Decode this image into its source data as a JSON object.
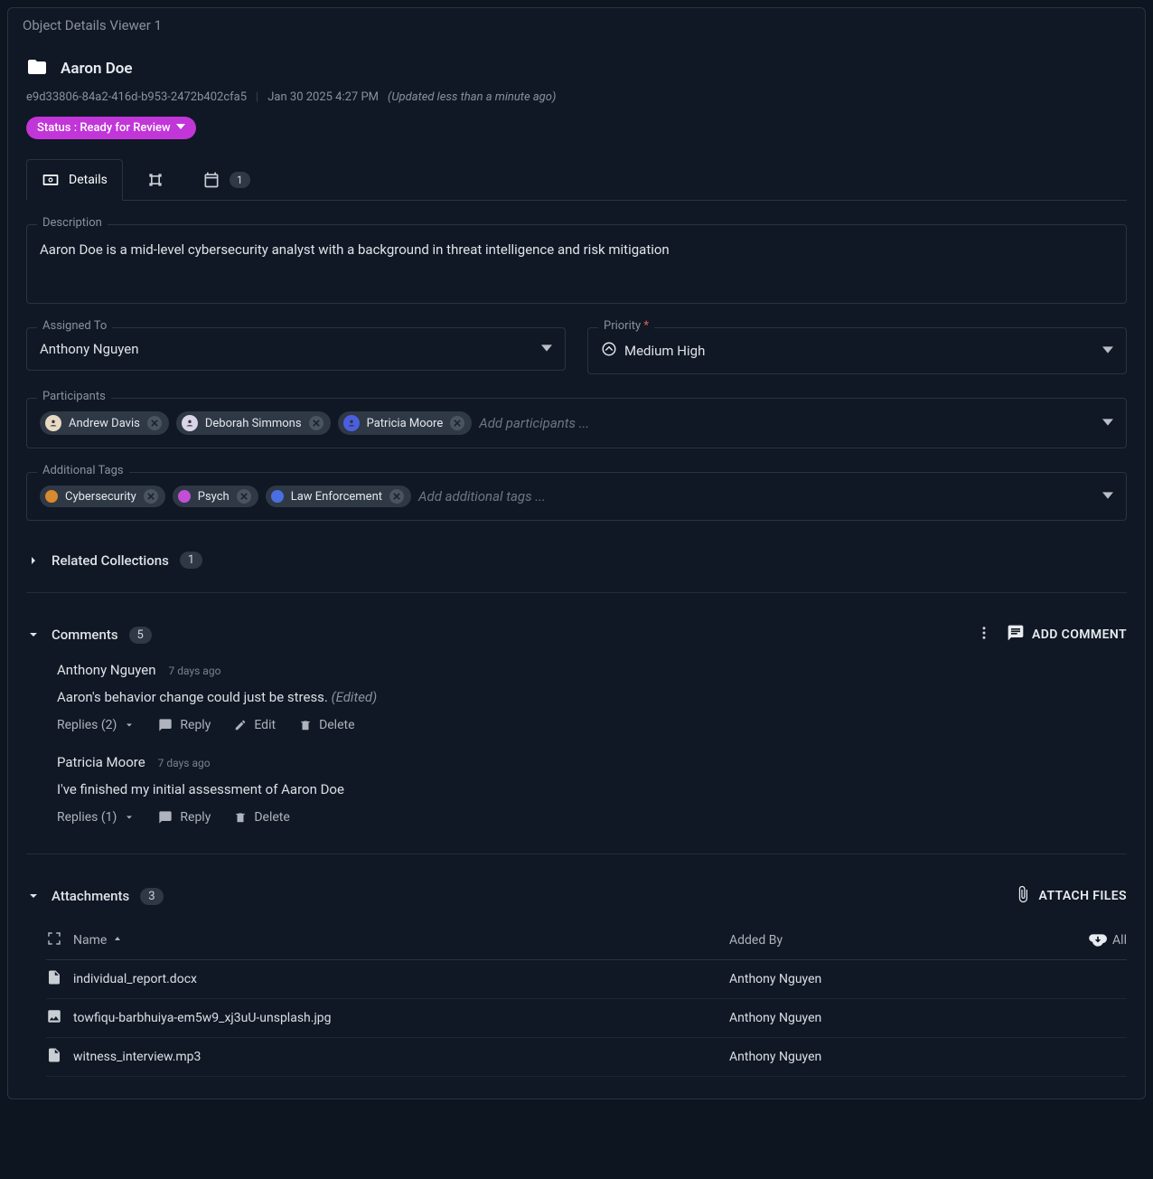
{
  "panel_title": "Object Details Viewer 1",
  "header": {
    "name": "Aaron Doe",
    "uuid": "e9d33806-84a2-416d-b953-2472b402cfa5",
    "timestamp": "Jan 30 2025 4:27 PM",
    "updated": "(Updated less than a minute ago)"
  },
  "status": {
    "label": "Status : Ready for Review"
  },
  "tabs": {
    "details": "Details",
    "calendar_count": "1"
  },
  "fields": {
    "description_label": "Description",
    "description_value": "Aaron Doe is a mid-level cybersecurity analyst with a background in threat intelligence and risk mitigation",
    "assigned_to_label": "Assigned To",
    "assigned_to_value": "Anthony Nguyen",
    "priority_label": "Priority",
    "priority_value": "Medium High",
    "participants_label": "Participants",
    "participants_placeholder": "Add participants ...",
    "participants": [
      {
        "name": "Andrew Davis",
        "bg": "#e8d9c5"
      },
      {
        "name": "Deborah Simmons",
        "bg": "#d9d4e8"
      },
      {
        "name": "Patricia Moore",
        "bg": "#4a5fe0"
      }
    ],
    "tags_label": "Additional Tags",
    "tags_placeholder": "Add additional tags ...",
    "tags": [
      {
        "name": "Cybersecurity",
        "color": "#d88a2e"
      },
      {
        "name": "Psych",
        "color": "#c24fd6"
      },
      {
        "name": "Law Enforcement",
        "color": "#4a6fe0"
      }
    ]
  },
  "related": {
    "title": "Related Collections",
    "count": "1"
  },
  "comments": {
    "title": "Comments",
    "count": "5",
    "add_label": "ADD COMMENT",
    "reply_label": "Reply",
    "edit_label": "Edit",
    "delete_label": "Delete",
    "items": [
      {
        "author": "Anthony Nguyen",
        "time": "7 days ago",
        "body": "Aaron's behavior change could just be stress.",
        "edited": "(Edited)",
        "replies_label": "Replies (2)",
        "can_edit": true
      },
      {
        "author": "Patricia Moore",
        "time": "7 days ago",
        "body": "I've finished my initial assessment of Aaron Doe",
        "edited": "",
        "replies_label": "Replies (1)",
        "can_edit": false
      }
    ]
  },
  "attachments": {
    "title": "Attachments",
    "count": "3",
    "attach_label": "ATTACH FILES",
    "col_name": "Name",
    "col_added_by": "Added By",
    "dl_all": "All",
    "rows": [
      {
        "icon": "doc",
        "name": "individual_report.docx",
        "by": "Anthony Nguyen"
      },
      {
        "icon": "img",
        "name": "towfiqu-barbhuiya-em5w9_xj3uU-unsplash.jpg",
        "by": "Anthony Nguyen"
      },
      {
        "icon": "doc",
        "name": "witness_interview.mp3",
        "by": "Anthony Nguyen"
      }
    ]
  }
}
